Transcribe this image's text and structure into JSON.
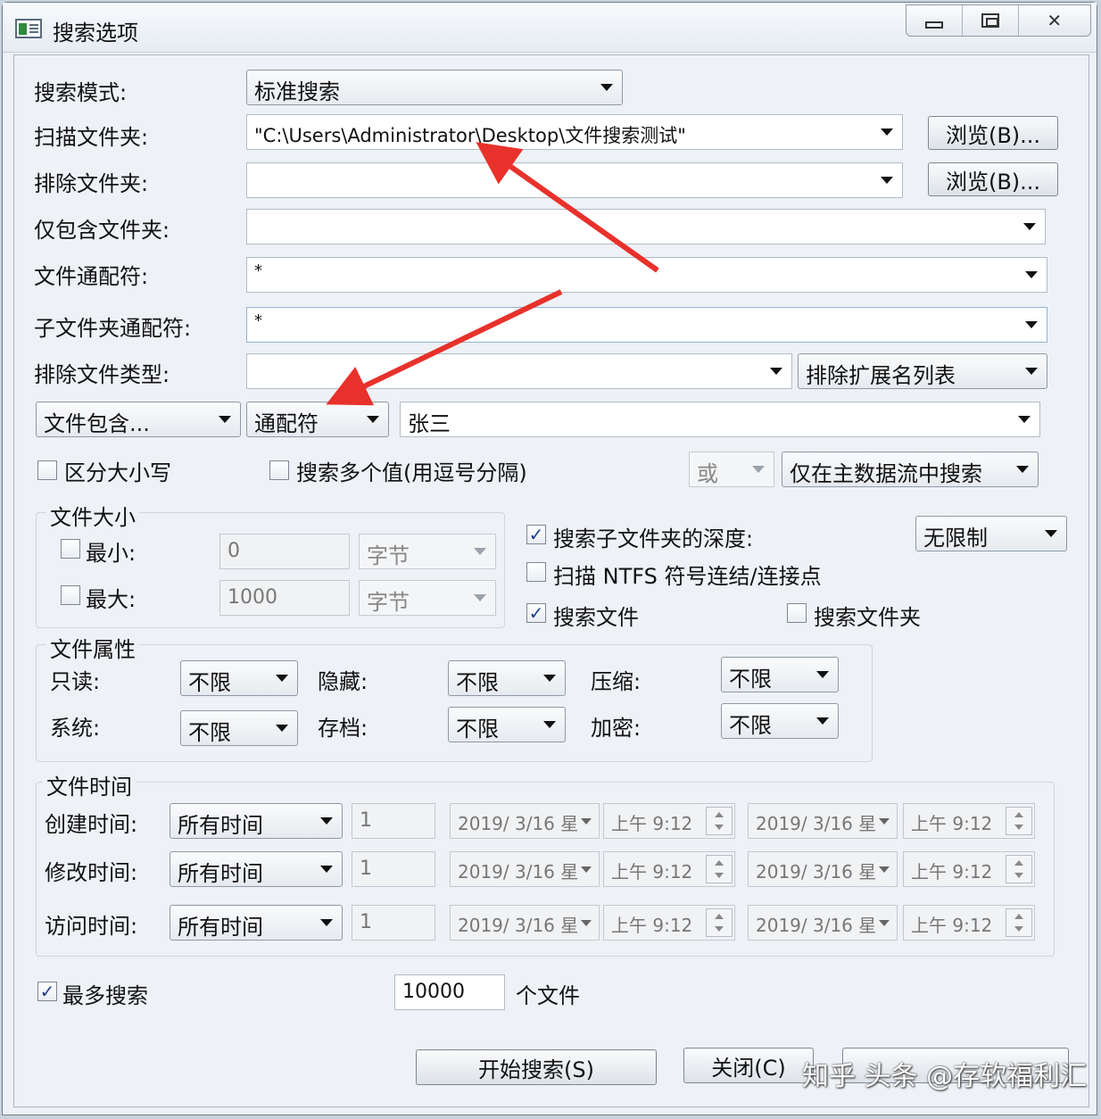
{
  "window": {
    "title": "搜索选项",
    "min": "minimize",
    "max": "maximize",
    "close": "✕"
  },
  "rows": {
    "search_mode": {
      "label": "搜索模式:",
      "value": "标准搜索"
    },
    "scan_folder": {
      "label": "扫描文件夹:",
      "value": "\"C:\\Users\\Administrator\\Desktop\\文件搜索测试\"",
      "browse": "浏览(B)..."
    },
    "exclude_folder": {
      "label": "排除文件夹:",
      "value": "",
      "browse": "浏览(B)..."
    },
    "include_only_folder": {
      "label": "仅包含文件夹:",
      "value": ""
    },
    "file_wildcard": {
      "label": "文件通配符:",
      "value": "*"
    },
    "subfolder_wildcard": {
      "label": "子文件夹通配符:",
      "value": "*"
    },
    "exclude_types": {
      "label": "排除文件类型:",
      "value": "",
      "list": "排除扩展名列表"
    },
    "content": {
      "mode": "文件包含...",
      "match": "通配符",
      "value": "张三"
    }
  },
  "options_row": {
    "case_sensitive": {
      "label": "区分大小写",
      "checked": false
    },
    "multi_value": {
      "label": "搜索多个值(用逗号分隔)",
      "checked": false
    },
    "or_select": "或",
    "stream": "仅在主数据流中搜索"
  },
  "file_size": {
    "title": "文件大小",
    "min": {
      "label": "最小:",
      "value": "0",
      "unit": "字节",
      "checked": false
    },
    "max": {
      "label": "最大:",
      "value": "1000",
      "unit": "字节",
      "checked": false
    }
  },
  "right_options": {
    "subfolder_depth": {
      "label": "搜索子文件夹的深度:",
      "checked": true,
      "value": "无限制"
    },
    "ntfs": {
      "label": "扫描 NTFS 符号连结/连接点",
      "checked": false
    },
    "search_files": {
      "label": "搜索文件",
      "checked": true
    },
    "search_folders": {
      "label": "搜索文件夹",
      "checked": false
    }
  },
  "attributes": {
    "title": "文件属性",
    "readonly": {
      "label": "只读:",
      "value": "不限"
    },
    "hidden": {
      "label": "隐藏:",
      "value": "不限"
    },
    "compressed": {
      "label": "压缩:",
      "value": "不限"
    },
    "system": {
      "label": "系统:",
      "value": "不限"
    },
    "archive": {
      "label": "存档:",
      "value": "不限"
    },
    "encrypted": {
      "label": "加密:",
      "value": "不限"
    }
  },
  "file_time": {
    "title": "文件时间",
    "rows": [
      {
        "label": "创建时间:",
        "mode": "所有时间",
        "num": "1",
        "date1": "2019/  3/16 星",
        "time1": "上午    9:12",
        "date2": "2019/  3/16 星",
        "time2": "上午    9:12"
      },
      {
        "label": "修改时间:",
        "mode": "所有时间",
        "num": "1",
        "date1": "2019/  3/16 星",
        "time1": "上午    9:12",
        "date2": "2019/  3/16 星",
        "time2": "上午    9:12"
      },
      {
        "label": "访问时间:",
        "mode": "所有时间",
        "num": "1",
        "date1": "2019/  3/16 星",
        "time1": "上午    9:12",
        "date2": "2019/  3/16 星",
        "time2": "上午    9:12"
      }
    ]
  },
  "max_search": {
    "label": "最多搜索",
    "checked": true,
    "value": "10000",
    "unit": "个文件"
  },
  "buttons": {
    "start": "开始搜索(S)",
    "close": "关闭(C)"
  },
  "watermark": "知乎 头条 @存软福利汇",
  "colors": {
    "arrow": "#e8312b",
    "check": "#1d3e8a"
  }
}
